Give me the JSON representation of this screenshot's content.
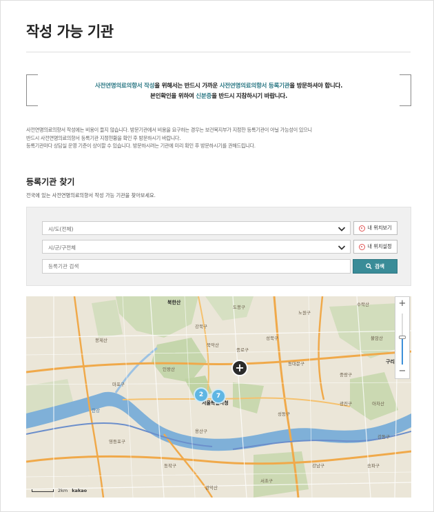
{
  "page": {
    "title": "작성 가능 기관"
  },
  "notice": {
    "line1_prefix": "",
    "line1_hl1": "사전연명의료의향서 작성",
    "line1_mid1": "을 위해서는 반드시 가까운 ",
    "line1_hl2": "사전연명의료의향서 등록기관",
    "line1_suffix": "을 방문하셔야 합니다.",
    "line2_prefix": "본인확인을 위하여 ",
    "line2_hl": "신분증",
    "line2_suffix": "을 반드시 지참하시기 바랍니다."
  },
  "description": {
    "line1": "사전연명의료의향서 작성에는 비용이 들지 않습니다. 방문기관에서 비용을 요구하는 경우는 보건복지부가 지정한 등록기관이 아닐 가능성이 있으니",
    "line2": "반드시 사전연명의료의향서 등록기관 지정현황을 확인 후 방문하시기 바랍니다.",
    "line3": "등록기관마다 상담실 운영 기준이 상이할 수 있습니다. 방문하시려는 기관에 미리 확인 후 방문하시기를 권해드립니다."
  },
  "finder": {
    "title": "등록기관 찾기",
    "subtitle": "전국에 있는 사전연명의료의향서 작성 가능 기관을 찾아보세요.",
    "select_sido": "시/도(전체)",
    "select_sigungu": "시/군/구전체",
    "keyword_placeholder": "등록기관 검색",
    "btn_view_location": "내 위치보기",
    "btn_set_location": "내 위치설정",
    "btn_search": "검색"
  },
  "map": {
    "clusters": [
      "2",
      "7"
    ],
    "scale_label": "2km",
    "brand": "kakao",
    "zoom_in": "+",
    "zoom_out": "−",
    "labels": [
      "북한산",
      "도봉구",
      "노원구",
      "강북구",
      "수락산",
      "불암산",
      "봉제산",
      "인왕산",
      "북악산",
      "종로구",
      "성북구",
      "동대문구",
      "중랑구",
      "서울특별시청",
      "마포구",
      "용산구",
      "성동구",
      "광진구",
      "한강",
      "영등포구",
      "동작구",
      "강남구",
      "송파구",
      "서초구",
      "관악산",
      "강동구",
      "구리",
      "아차산"
    ]
  }
}
